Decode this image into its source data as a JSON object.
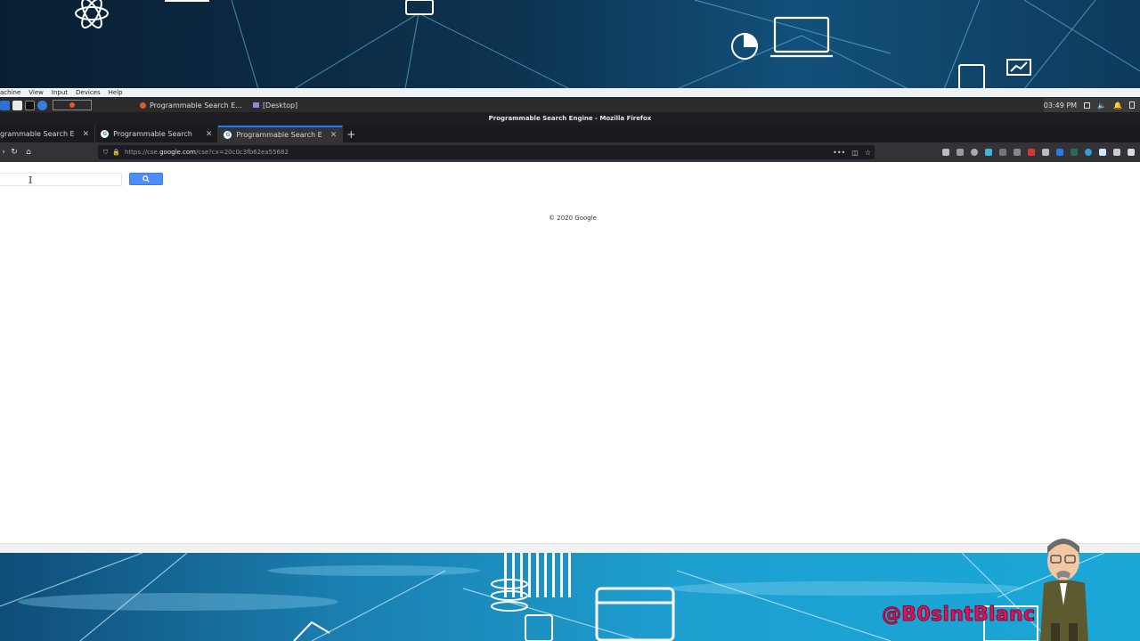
{
  "vbox_menu": [
    "achine",
    "View",
    "Input",
    "Devices",
    "Help"
  ],
  "taskbar": {
    "tasks": [
      {
        "label": "Programmable Search E..."
      },
      {
        "label": "[Desktop]"
      }
    ],
    "clock": "03:49 PM"
  },
  "firefox": {
    "window_title": "Programmable Search Engine - Mozilla Firefox",
    "tabs": [
      {
        "label": "grammable Search E",
        "active": false
      },
      {
        "label": "Programmable Search",
        "active": false
      },
      {
        "label": "Programmable Search E",
        "active": true
      }
    ],
    "url_scheme": "https://cse.",
    "url_host": "google.com",
    "url_path": "/cse?cx=20c0c3fb62ea55682"
  },
  "page": {
    "search_value": "",
    "copyright": "© 2020 Google"
  },
  "overlay": {
    "handle": "@B0sintBlanc"
  },
  "colors": {
    "accent": "#0a84ff",
    "search_button": "#4e8ef7",
    "handle": "#e0145a"
  }
}
